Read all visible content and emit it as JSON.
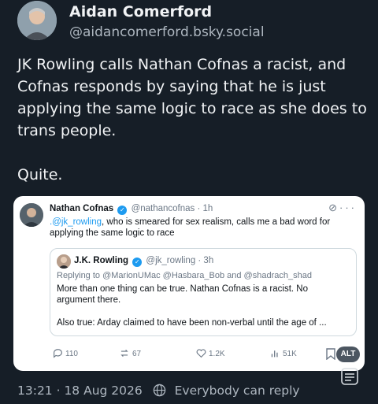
{
  "post": {
    "author_name": "Aidan Comerford",
    "author_handle": "@aidancomerford.bsky.social",
    "text_line1": "JK Rowling calls Nathan Cofnas a racist, and Cofnas responds by saying that he is just applying the same logic to race as she does to trans people.",
    "text_line2": "Quite.",
    "timestamp": "13:21 · 18 Aug 2026",
    "reply_setting": "Everybody can reply"
  },
  "quoted": {
    "name": "Nathan Cofnas",
    "handle": "@nathancofnas · 1h",
    "mention": ".@jk_rowling",
    "text": ", who is smeared for sex realism, calls me a bad word for applying the same logic to race",
    "inner": {
      "name": "J.K. Rowling",
      "handle": "@jk_rowling · 3h",
      "replying_to": "Replying to @MarionUMac @Hasbara_Bob and @shadrach_shad",
      "text1": "More than one thing can be true. Nathan Cofnas is a racist. No argument there.",
      "text2": "Also true: Arday claimed to have been non-verbal until the age of ..."
    },
    "actions": {
      "replies": "110",
      "reposts": "67",
      "likes": "1.2K",
      "views": "51K"
    },
    "alt_badge": "ALT"
  },
  "icons": {
    "verified": "verified-badge-icon",
    "grok": "grok-icon",
    "more": "more-icon",
    "reply": "reply-icon",
    "repost": "repost-icon",
    "like": "heart-icon",
    "views": "views-icon",
    "bookmark": "bookmark-icon",
    "globe": "globe-icon"
  },
  "colors": {
    "background": "#161e27",
    "accent": "#1d9bf0",
    "card_bg": "#ffffff"
  }
}
